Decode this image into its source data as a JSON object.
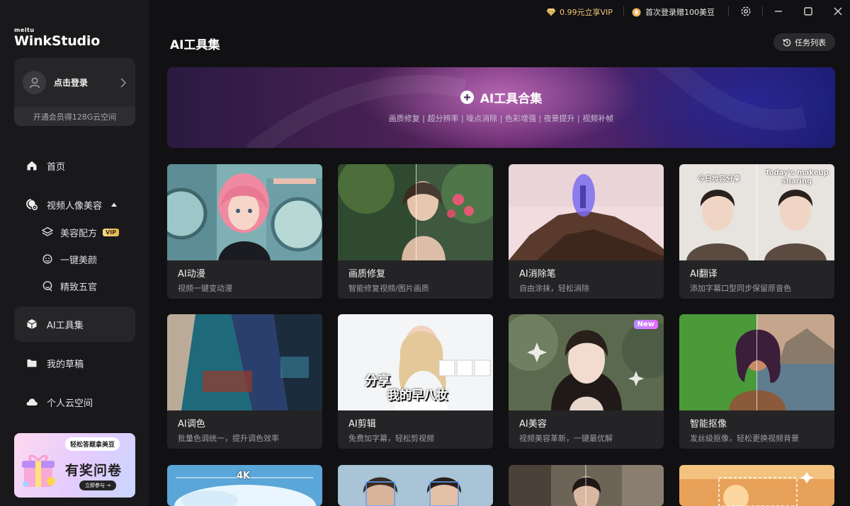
{
  "app": {
    "brand_small": "meitu",
    "brand_name": "WinkStudio"
  },
  "topbar": {
    "vip_offer": "0.99元立享VIP",
    "beans_offer": "首次登录赠100美豆"
  },
  "sidebar": {
    "login_label": "点击登录",
    "member_tip": "开通会员得128G云空间",
    "nav": {
      "home": "首页",
      "portrait": "视频人像美容",
      "beauty_formula": "美容配方",
      "vip_badge": "VIP",
      "one_click": "一键美颜",
      "features": "精致五官",
      "ai_tools": "AI工具集",
      "drafts": "我的草稿",
      "cloud": "个人云空间"
    },
    "promo": {
      "pill": "轻松答题拿美豆",
      "headline": "有奖问卷",
      "join": "立即参与 →"
    }
  },
  "main": {
    "title": "AI工具集",
    "task_list": "任务列表",
    "hero": {
      "title": "AI工具合集",
      "subtitle": "画质修复 | 超分辨率 | 噪点消除 | 色彩增强 | 夜景提升 | 视频补帧"
    },
    "cards": [
      {
        "title": "AI动漫",
        "desc": "视频一键变动漫"
      },
      {
        "title": "画质修复",
        "desc": "智能修复视频/图片画质"
      },
      {
        "title": "AI消除笔",
        "desc": "自由涂抹，轻松消除"
      },
      {
        "title": "AI翻译",
        "desc": "添加字幕口型同步保留原音色",
        "caption_left": "今日妆容分享",
        "caption_right": "Today's makeup sharing"
      },
      {
        "title": "AI调色",
        "desc": "批量色调统一，提升调色效率"
      },
      {
        "title": "AI剪辑",
        "desc": "免费加字幕，轻松剪视频",
        "overlay_line1": "分享",
        "overlay_line2": "我的早八妆"
      },
      {
        "title": "AI美容",
        "desc": "视频美容革新，一键最优解",
        "badge": "New"
      },
      {
        "title": "智能抠像",
        "desc": "发丝级抠像，轻松更换视频背景"
      }
    ],
    "partial_cards": [
      {
        "label": "4K"
      }
    ]
  }
}
